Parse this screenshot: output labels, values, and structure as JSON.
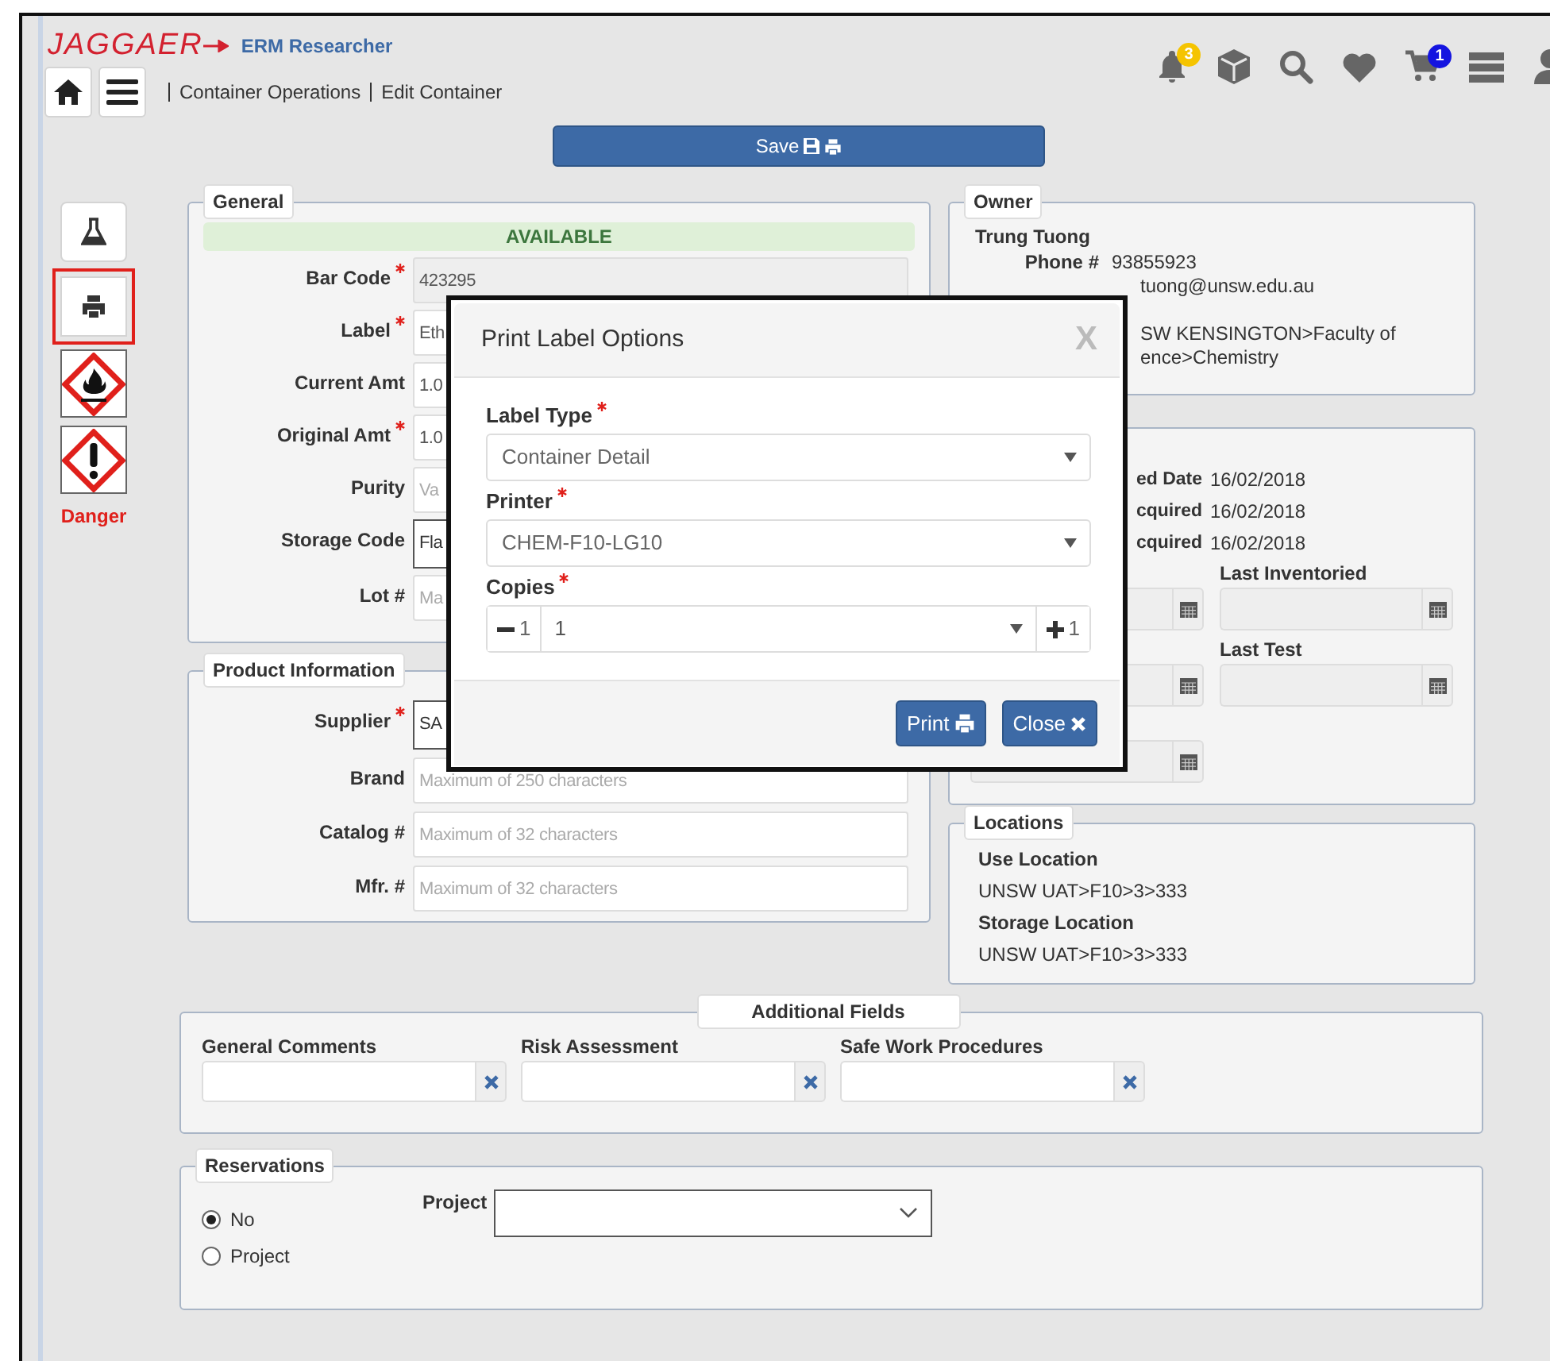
{
  "header": {
    "logo": "JAGGAER",
    "app_name": "ERM Researcher",
    "icons": [
      {
        "kind": "bell",
        "badge": "3",
        "color": "#f5c400"
      },
      {
        "kind": "cube"
      },
      {
        "kind": "search"
      },
      {
        "kind": "heart"
      },
      {
        "kind": "cart",
        "badge": "1",
        "color": "#1414e0"
      },
      {
        "kind": "list"
      },
      {
        "kind": "user"
      }
    ]
  },
  "breadcrumb": [
    "Container Operations",
    "Edit Container"
  ],
  "save_button": {
    "label": "Save"
  },
  "sidebar": {
    "tools": [
      {
        "kind": "beaker",
        "highlighted": false
      },
      {
        "kind": "printer",
        "highlighted": true
      }
    ],
    "hazards": [
      {
        "kind": "flame"
      },
      {
        "kind": "exclamation"
      }
    ],
    "signal_word": "Danger"
  },
  "general": {
    "title": "General",
    "status": "AVAILABLE",
    "fields": [
      {
        "label": "Bar Code",
        "required": true,
        "kind": "readonly",
        "value": "423295"
      },
      {
        "label": "Label",
        "required": true,
        "kind": "text",
        "value": "Eth"
      },
      {
        "label": "Current Amt",
        "required": false,
        "kind": "text",
        "value": "1.0"
      },
      {
        "label": "Original Amt",
        "required": true,
        "kind": "text",
        "value": "1.0"
      },
      {
        "label": "Purity",
        "required": false,
        "kind": "text",
        "placeholder": "Va"
      },
      {
        "label": "Storage Code",
        "required": false,
        "kind": "select",
        "value": "Fla"
      },
      {
        "label": "Lot #",
        "required": false,
        "kind": "text",
        "placeholder": "Ma"
      }
    ]
  },
  "product": {
    "title": "Product Information",
    "fields": [
      {
        "label": "Supplier",
        "required": true,
        "kind": "select",
        "value": "SA"
      },
      {
        "label": "Brand",
        "required": false,
        "kind": "text",
        "placeholder": "Maximum of 250 characters"
      },
      {
        "label": "Catalog #",
        "required": false,
        "kind": "text",
        "placeholder": "Maximum of 32 characters"
      },
      {
        "label": "Mfr. #",
        "required": false,
        "kind": "text",
        "placeholder": "Maximum of 32 characters"
      }
    ]
  },
  "owner": {
    "title": "Owner",
    "name": "Trung Tuong",
    "rows": [
      {
        "label": "Phone #",
        "value": "93855923"
      },
      {
        "value": "tuong@unsw.edu.au"
      },
      {
        "value": "SW KENSINGTON>Faculty of"
      },
      {
        "value": "ence>Chemistry"
      }
    ]
  },
  "dates": {
    "rows": [
      {
        "label": "ed Date",
        "value": "16/02/2018"
      },
      {
        "label": "cquired",
        "value": "16/02/2018"
      },
      {
        "label": "cquired",
        "value": "16/02/2018"
      }
    ],
    "date_fields": [
      {
        "kind": "unlabeled"
      },
      {
        "kind": "labeled",
        "label": "Last Inventoried"
      },
      {
        "kind": "unlabeled"
      },
      {
        "kind": "labeled",
        "label": "Last Test"
      },
      {
        "kind": "unlabeled"
      }
    ]
  },
  "locations": {
    "title": "Locations",
    "items": [
      {
        "label": "Use Location",
        "value": "UNSW UAT>F10>3>333"
      },
      {
        "label": "Storage Location",
        "value": "UNSW UAT>F10>3>333"
      }
    ]
  },
  "additional": {
    "title": "Additional Fields",
    "fields": [
      {
        "label": "General Comments"
      },
      {
        "label": "Risk Assessment"
      },
      {
        "label": "Safe Work Procedures"
      }
    ]
  },
  "reservations": {
    "title": "Reservations",
    "options": [
      {
        "label": "No",
        "selected": true
      },
      {
        "label": "Project",
        "selected": false
      }
    ],
    "project_label": "Project"
  },
  "modal": {
    "title": "Print Label Options",
    "close": "X",
    "fields": [
      {
        "label": "Label Type",
        "required": true,
        "kind": "select",
        "value": "Container Detail"
      },
      {
        "label": "Printer",
        "required": true,
        "kind": "select",
        "value": "CHEM-F10-LG10"
      },
      {
        "label": "Copies",
        "required": true,
        "kind": "stepper",
        "value": "1",
        "decrement": "1",
        "increment": "1"
      }
    ],
    "buttons": [
      {
        "kind": "print",
        "label": "Print"
      },
      {
        "kind": "close",
        "label": "Close"
      }
    ]
  }
}
